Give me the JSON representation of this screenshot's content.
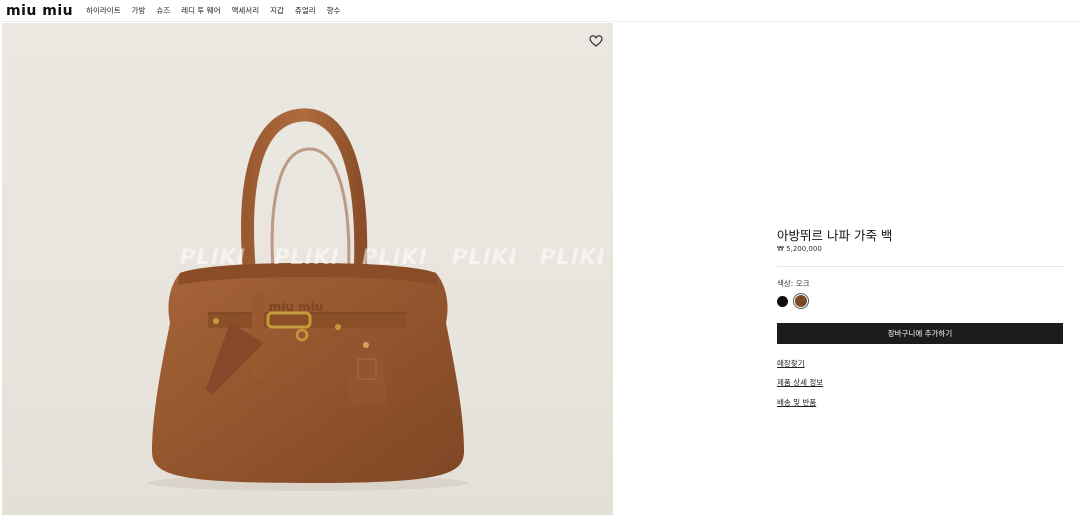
{
  "header": {
    "logo": "miu miu",
    "nav": [
      "하이라이트",
      "가방",
      "슈즈",
      "레디 투 웨어",
      "액세서리",
      "지갑",
      "쥬얼리",
      "향수"
    ]
  },
  "image": {
    "watermark": "PLIKI",
    "bag_logo": "miu miu"
  },
  "product": {
    "title": "아방뛰르 나파 가죽 백",
    "price": "₩ 5,200,000",
    "color_label": "색상: 오크",
    "swatches": [
      {
        "name": "black",
        "color": "#0c0c0c",
        "selected": false
      },
      {
        "name": "oak",
        "color": "#7b4a25",
        "selected": true
      }
    ],
    "cart_button": "장바구니에 추가하기",
    "links": [
      "매장찾기",
      "제품 상세 정보",
      "배송 및 반품"
    ]
  }
}
